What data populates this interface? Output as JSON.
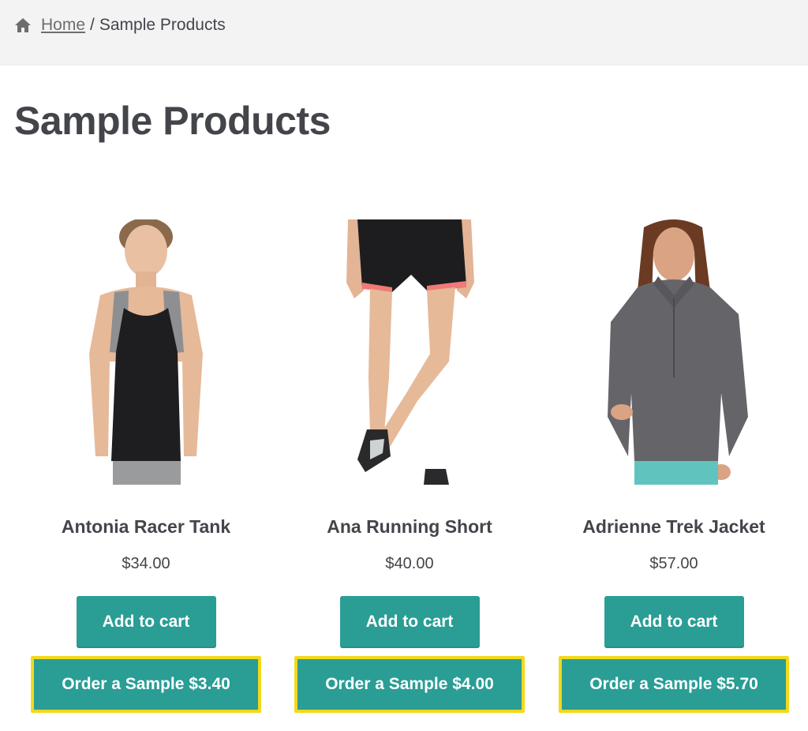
{
  "breadcrumb": {
    "icon": "home-icon",
    "home_label": "Home",
    "separator": "/",
    "current": "Sample Products"
  },
  "page": {
    "title": "Sample Products"
  },
  "colors": {
    "button": "#2a9d95",
    "highlight_border": "#f3d91c",
    "text": "#43454b",
    "topbar": "#f3f3f3"
  },
  "products": [
    {
      "name": "Antonia Racer Tank",
      "price": "$34.00",
      "add_to_cart": "Add to cart",
      "sample_label": "Order a Sample $3.40"
    },
    {
      "name": "Ana Running Short",
      "price": "$40.00",
      "add_to_cart": "Add to cart",
      "sample_label": "Order a Sample $4.00"
    },
    {
      "name": "Adrienne Trek Jacket",
      "price": "$57.00",
      "add_to_cart": "Add to cart",
      "sample_label": "Order a Sample $5.70"
    }
  ]
}
